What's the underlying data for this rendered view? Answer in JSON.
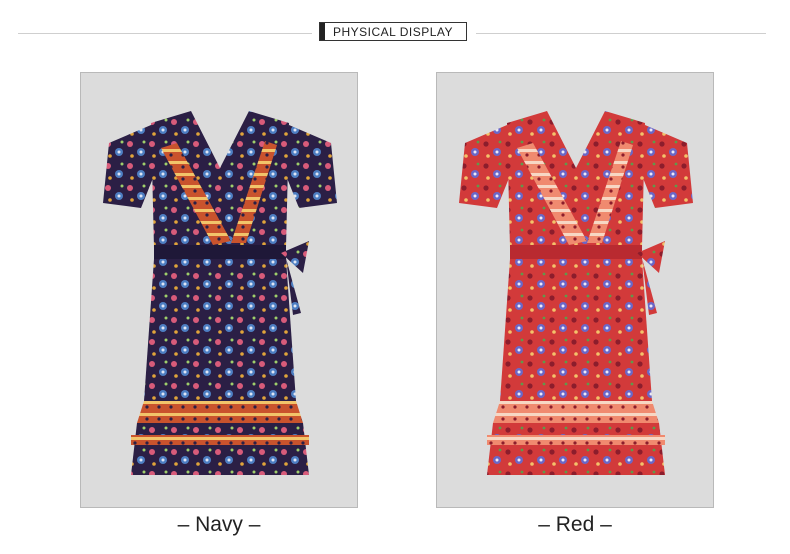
{
  "header": {
    "title": "PHYSICAL DISPLAY"
  },
  "products": [
    {
      "label": "– Navy –",
      "colors": {
        "base": "#2b1f45",
        "trim": "#c9532d",
        "flower": "#4d7ec2",
        "accent": "#d85b7a"
      }
    },
    {
      "label": "– Red –",
      "colors": {
        "base": "#d23a3a",
        "trim": "#f08a6f",
        "flower": "#6a67c7",
        "accent": "#8c1d2c"
      }
    }
  ]
}
